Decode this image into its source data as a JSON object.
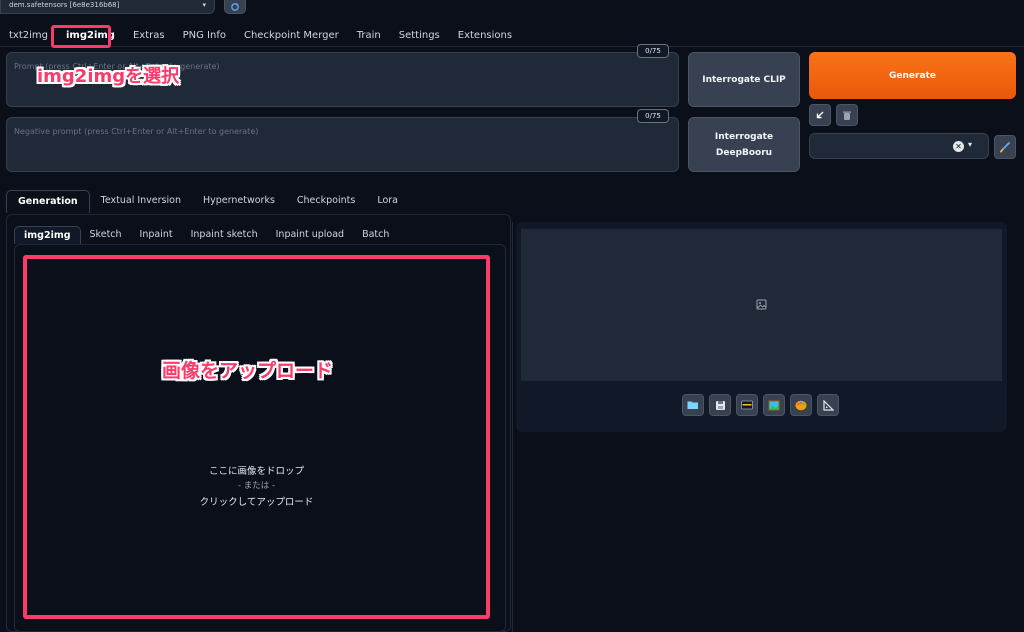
{
  "model": {
    "value": "dem.safetensors [6e8e316b68]"
  },
  "main_tabs": [
    "txt2img",
    "img2img",
    "Extras",
    "PNG Info",
    "Checkpoint Merger",
    "Train",
    "Settings",
    "Extensions"
  ],
  "prompt": {
    "placeholder": "Prompt (press Ctrl+Enter or Alt+Enter to generate)",
    "token_count": "0/75"
  },
  "negative_prompt": {
    "placeholder": "Negative prompt (press Ctrl+Enter or Alt+Enter to generate)",
    "token_count": "0/75"
  },
  "buttons": {
    "interrogate_clip": "Interrogate CLIP",
    "interrogate_deepbooru_line1": "Interrogate",
    "interrogate_deepbooru_line2": "DeepBooru",
    "generate": "Generate"
  },
  "settings_tabs": [
    "Generation",
    "Textual Inversion",
    "Hypernetworks",
    "Checkpoints",
    "Lora"
  ],
  "image_tabs": [
    "img2img",
    "Sketch",
    "Inpaint",
    "Inpaint sketch",
    "Inpaint upload",
    "Batch"
  ],
  "drop_zone": {
    "line1": "ここに画像をドロップ",
    "line2": "- または -",
    "line3": "クリックしてアップロード"
  },
  "output_tools": [
    "folder-icon",
    "save-icon",
    "zip-icon",
    "image-icon",
    "palette-icon",
    "ruler-icon"
  ],
  "annotations": {
    "select_tab": "img2imgを選択",
    "upload_image": "画像をアップロード"
  },
  "colors": {
    "accent": "#f97316",
    "annotation": "#ff3b6b",
    "background": "#0b0f19"
  }
}
